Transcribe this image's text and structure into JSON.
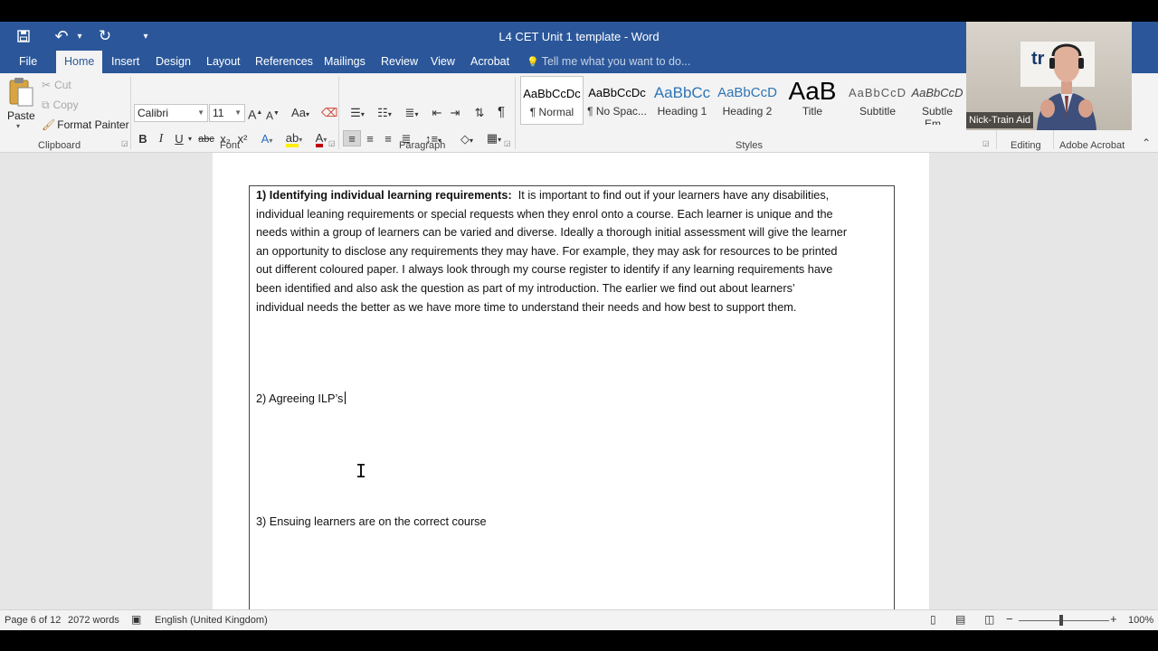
{
  "window": {
    "title": "L4 CET Unit 1 template - Word"
  },
  "qat": {
    "save": "💾",
    "undo": "↶",
    "undo_dd": "▾",
    "redo": "↻",
    "customize": "▾"
  },
  "tabs": [
    "File",
    "Home",
    "Insert",
    "Design",
    "Layout",
    "References",
    "Mailings",
    "Review",
    "View",
    "Acrobat"
  ],
  "tellme": {
    "icon": "💡",
    "placeholder": "Tell me what you want to do..."
  },
  "ribbon": {
    "clipboard": {
      "label": "Clipboard",
      "paste": "Paste",
      "cut": "Cut",
      "copy": "Copy",
      "format_painter": "Format Painter"
    },
    "font": {
      "label": "Font",
      "family": "Calibri",
      "size": "11",
      "bold": "B",
      "italic": "I",
      "underline": "U",
      "strike": "abc",
      "subscript": "x₂",
      "superscript": "x²",
      "grow": "A",
      "shrink": "A",
      "change_case": "Aa",
      "font_color": "A"
    },
    "paragraph": {
      "label": "Paragraph",
      "show_marks": "¶"
    },
    "styles": {
      "label": "Styles",
      "items": [
        {
          "sample": "AaBbCcDc",
          "name": "¶ Normal"
        },
        {
          "sample": "AaBbCcDc",
          "name": "¶ No Spac..."
        },
        {
          "sample": "AaBbCc",
          "name": "Heading 1"
        },
        {
          "sample": "AaBbCcD",
          "name": "Heading 2"
        },
        {
          "sample": "AaB",
          "name": "Title"
        },
        {
          "sample": "AaBbCcD",
          "name": "Subtitle"
        },
        {
          "sample": "AaBbCcD",
          "name": "Subtle Em..."
        }
      ]
    },
    "editing": {
      "label": "Editing"
    },
    "acrobat": {
      "label": "Adobe Acrobat"
    }
  },
  "webcam": {
    "sign_text": "tr",
    "name": "Nick-Train Aid"
  },
  "document": {
    "para1_heading": "1)  Identifying individual learning requirements:",
    "para1_lines": [
      "It is important to find out if your learners have any disabilities,",
      "individual leaning requirements or special requests when they enrol onto a course. Each learner is unique and the",
      "needs within a group of learners can be varied and diverse. Ideally a thorough initial assessment will give the learner",
      "an opportunity to disclose any requirements they may have. For example, they may ask for resources to be printed",
      "out different coloured paper. I always look through my course register to identify if any learning requirements have",
      "been identified and also ask the question as part of my introduction. The earlier we find out about learners’",
      "individual needs the better as we have more time to understand their needs and how best to support them."
    ],
    "para2": "2) Agreeing ILP’s",
    "para3": "3) Ensuing learners are on the correct course"
  },
  "status": {
    "page": "Page 6 of 12",
    "words": "2072 words",
    "language": "English (United Kingdom)",
    "zoom": "100%",
    "zoom_minus": "−",
    "zoom_plus": "+"
  }
}
